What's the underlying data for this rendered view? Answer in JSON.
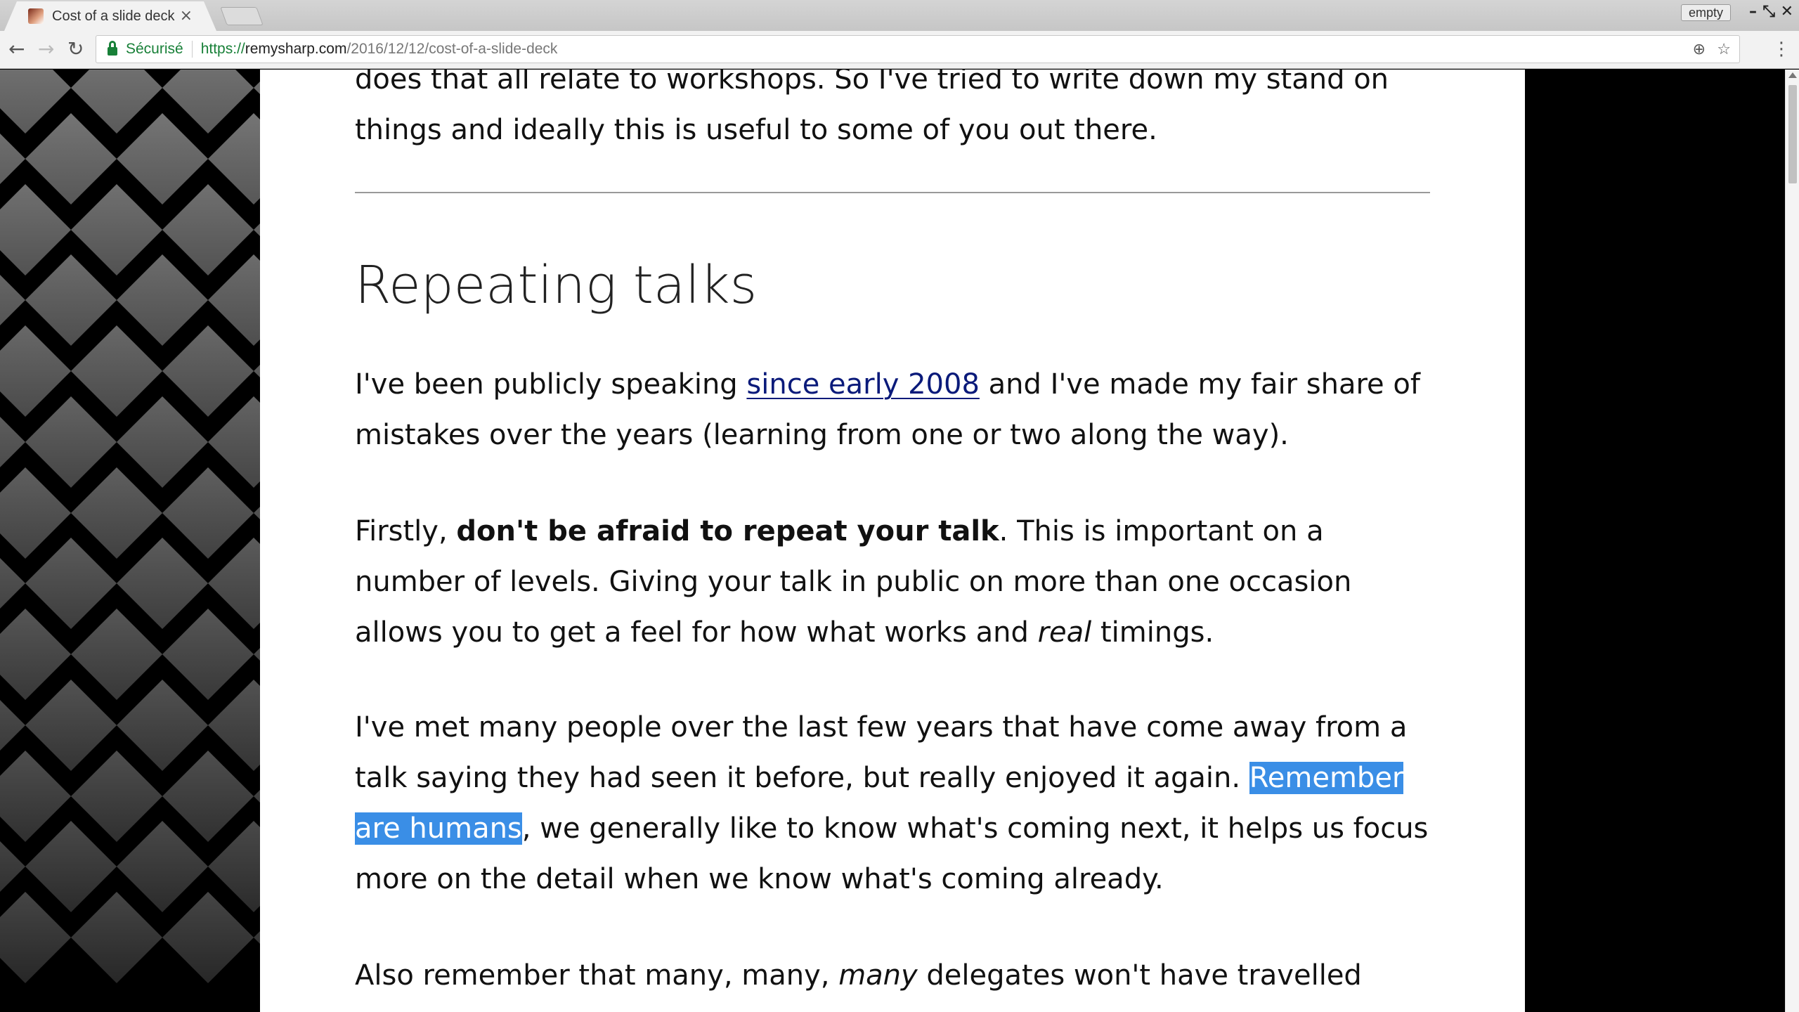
{
  "browser": {
    "tab_title": "Cost of a slide deck",
    "tab_close": "×",
    "profile_label": "empty",
    "minimize": "–",
    "restore": "⤡",
    "close": "✕"
  },
  "toolbar": {
    "back": "←",
    "forward": "→",
    "reload": "↻",
    "secure_label": "Sécurisé",
    "url_scheme": "https://",
    "url_host": "remysharp.com",
    "url_path": "/2016/12/12/cost-of-a-slide-deck",
    "zoom_icon": "⊕",
    "star_icon": "☆",
    "menu_icon": "⋮"
  },
  "article": {
    "intro_line1": "does that all relate to workshops. So I've tried to write down my stand on",
    "intro_line2": "things and ideally this is useful to some of you out there.",
    "heading": "Repeating talks",
    "p2_a": "I've been publicly speaking ",
    "p2_link": "since early 2008",
    "p2_b": " and I've made my fair share of mistakes over the years (learning from one or two along the way).",
    "p3_a": "Firstly, ",
    "p3_bold": "don't be afraid to repeat your talk",
    "p3_b": ". This is important on a number of levels. Giving your talk in public on more than one occasion allows you to get a feel for how what works and ",
    "p3_italic": "real",
    "p3_c": " timings.",
    "p4_a": "I've met many people over the last few years that have come away from a talk saying they had seen it before, but really enjoyed it again. ",
    "p4_selected": "Remember are humans",
    "p4_b": ", we generally like to know what's coming next, it helps us focus more on the detail when we know what's coming already.",
    "p5_a": "Also remember that many, many, ",
    "p5_italic": "many",
    "p5_b": " delegates won't have travelled"
  }
}
